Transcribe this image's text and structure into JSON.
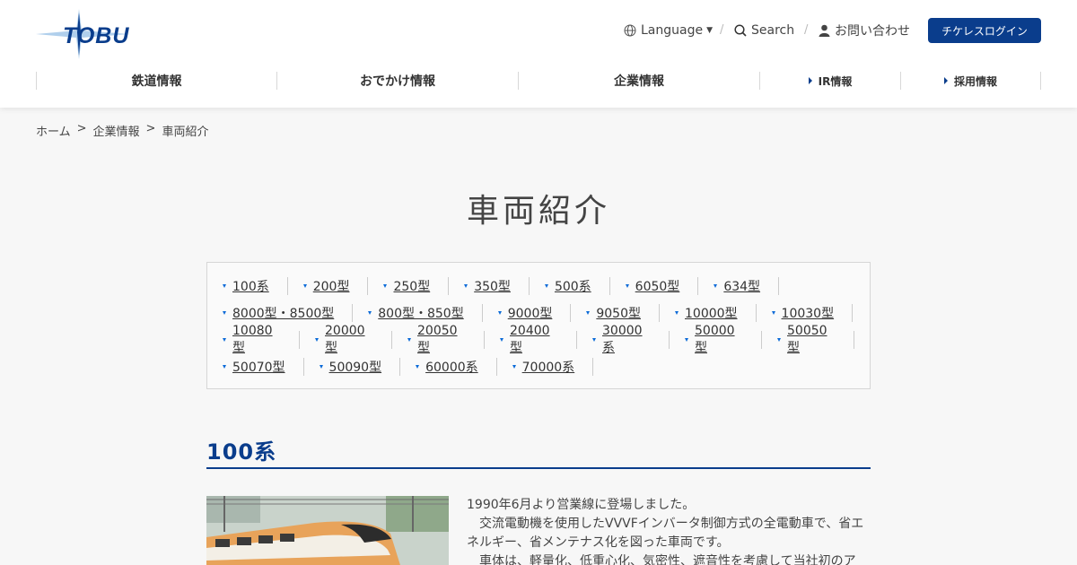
{
  "header": {
    "logo_text": "TOBU",
    "language_label": "Language",
    "search_label": "Search",
    "contact_label": "お問い合わせ",
    "login_label": "チケレスログイン"
  },
  "nav": {
    "items": [
      "鉄道情報",
      "おでかけ情報",
      "企業情報",
      "IR情報",
      "採用情報"
    ]
  },
  "breadcrumb": {
    "home": "ホーム",
    "parent": "企業情報",
    "current": "車両紹介",
    "separator": ">"
  },
  "page": {
    "title": "車両紹介"
  },
  "models": [
    "100系",
    "200型",
    "250型",
    "350型",
    "500系",
    "6050型",
    "634型",
    "8000型・8500型",
    "800型・850型",
    "9000型",
    "9050型",
    "10000型",
    "10030型",
    "10080型",
    "20000型",
    "20050型",
    "20400型",
    "30000系",
    "50000型",
    "50050型",
    "50070型",
    "50090型",
    "60000系",
    "70000系"
  ],
  "section": {
    "title": "100系",
    "paragraphs": [
      "1990年6月より営業線に登場しました。",
      "　交流電動機を使用したVVVFインバータ制御方式の全電動車で、省エネルギー、省メンテナス化を図った車両です。",
      "　車体は、軽量化、低重心化、気密性、遮音性を考慮して当社初のア"
    ]
  },
  "colors": {
    "brand": "#0a3d8c",
    "accent_blue": "#0a6ad8"
  }
}
